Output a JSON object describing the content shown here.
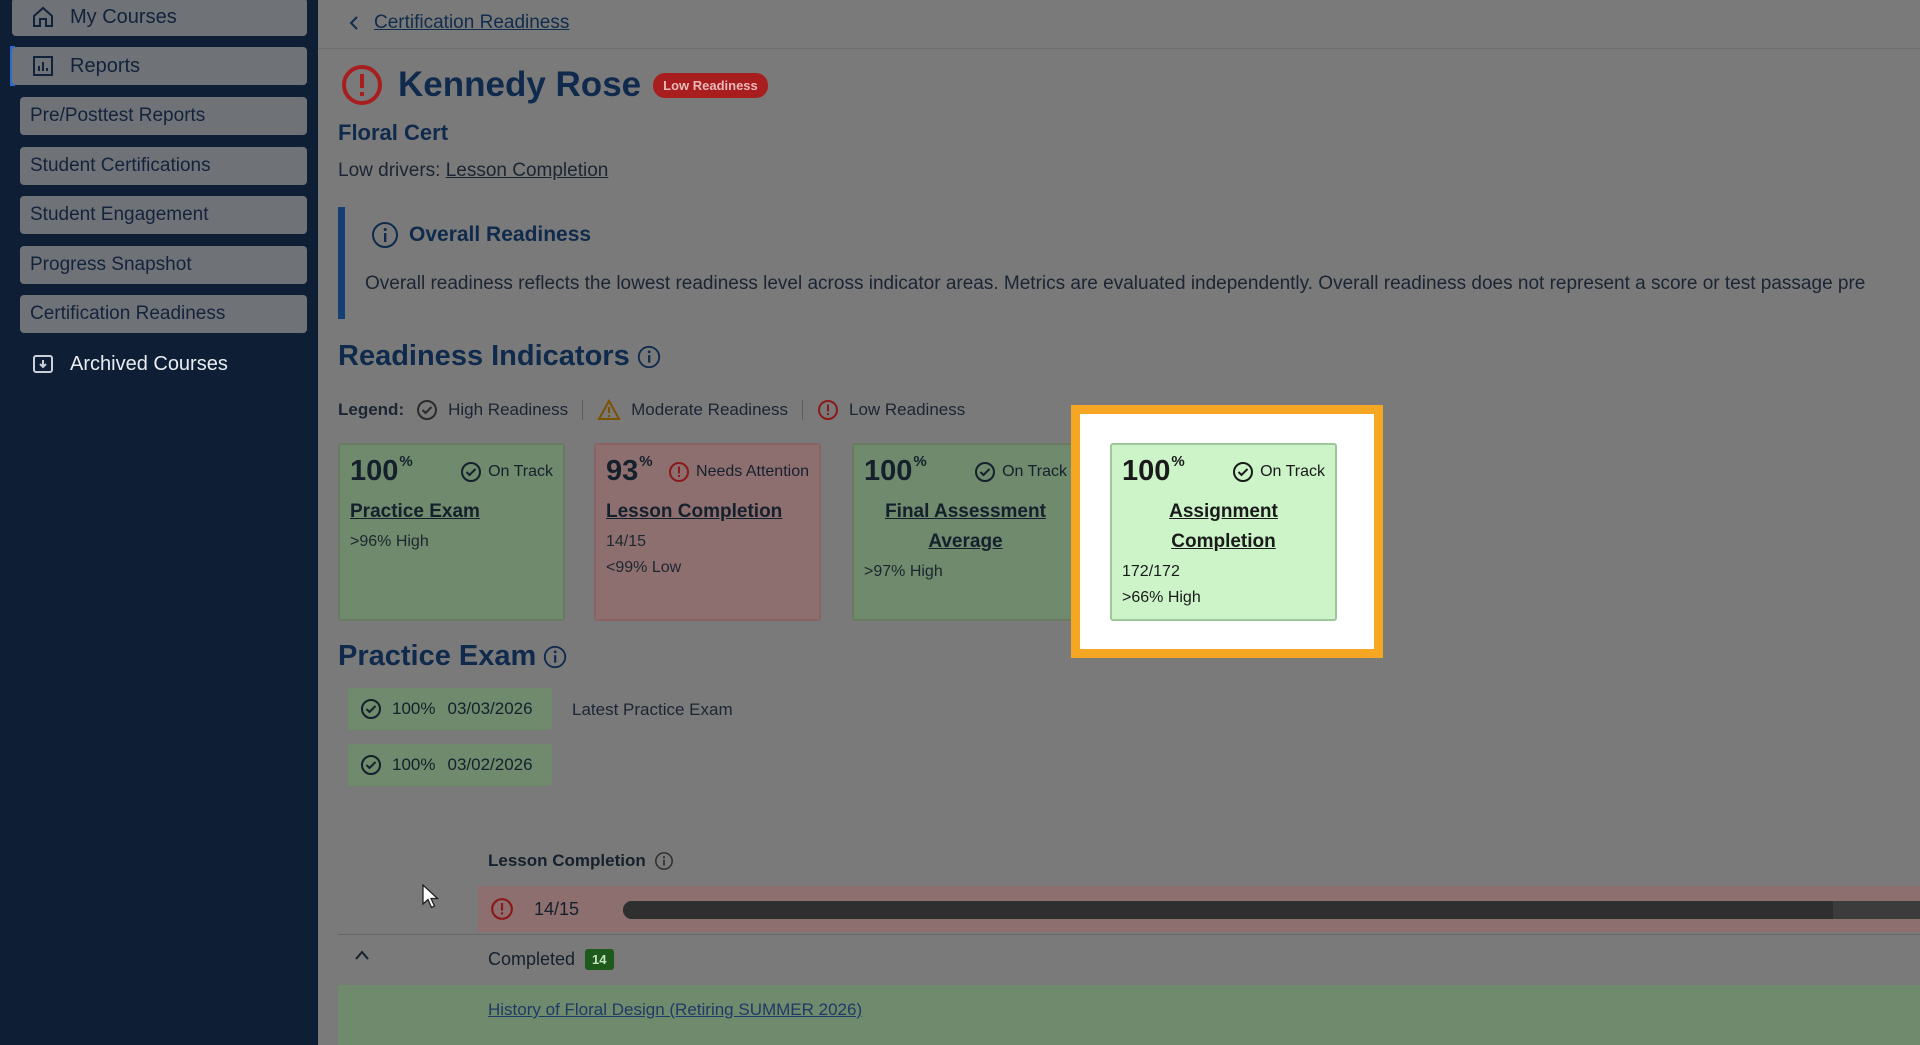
{
  "sidebar": {
    "items": [
      {
        "label": "My Courses",
        "icon": "home-icon"
      },
      {
        "label": "Reports",
        "icon": "chart-icon"
      },
      {
        "label": "Pre/Posttest Reports"
      },
      {
        "label": "Student Certifications"
      },
      {
        "label": "Student Engagement"
      },
      {
        "label": "Progress Snapshot"
      },
      {
        "label": "Certification Readiness"
      },
      {
        "label": "Archived Courses",
        "icon": "archive-icon"
      }
    ]
  },
  "breadcrumb": {
    "back_label": "Certification Readiness"
  },
  "student": {
    "name": "Kennedy Rose",
    "readiness_badge": "Low Readiness",
    "course": "Floral Cert",
    "low_drivers_label": "Low drivers:",
    "low_drivers_value": "Lesson Completion"
  },
  "overall": {
    "title": "Overall Readiness",
    "description": "Overall readiness reflects the lowest readiness level across indicator areas. Metrics are evaluated independently. Overall readiness does not represent a score or test passage pre"
  },
  "indicators": {
    "title": "Readiness Indicators",
    "legend_label": "Legend:",
    "legend": {
      "high": "High Readiness",
      "moderate": "Moderate Readiness",
      "low": "Low Readiness"
    },
    "cards": [
      {
        "pct": "100",
        "pct_sign": "%",
        "status": "On Track",
        "name": "Practice Exam",
        "line1": ">96% High",
        "line2": ""
      },
      {
        "pct": "93",
        "pct_sign": "%",
        "status": "Needs Attention",
        "name": "Lesson Completion",
        "line1": "14/15",
        "line2": "<99% Low"
      },
      {
        "pct": "100",
        "pct_sign": "%",
        "status": "On Track",
        "name": "Final Assessment Average",
        "line1": ">97% High",
        "line2": ""
      },
      {
        "pct": "100",
        "pct_sign": "%",
        "status": "On Track",
        "name": "Assignment Completion",
        "line1": "172/172",
        "line2": ">66% High"
      }
    ]
  },
  "practice_exam": {
    "title": "Practice Exam",
    "attempts": [
      {
        "score": "100%",
        "date": "03/03/2026"
      },
      {
        "score": "100%",
        "date": "03/02/2026"
      }
    ],
    "latest_label": "Latest Practice Exam"
  },
  "lesson_completion": {
    "title": "Lesson Completion",
    "fraction": "14/15",
    "progress": 0.933,
    "completed_label": "Completed",
    "completed_count": "14",
    "lessons": [
      "History of Floral Design (Retiring SUMMER 2026)"
    ]
  },
  "colors": {
    "highlight_border": "#f5a623",
    "low_badge": "#a81e1e",
    "sidebar_bg": "#0d1e35"
  }
}
